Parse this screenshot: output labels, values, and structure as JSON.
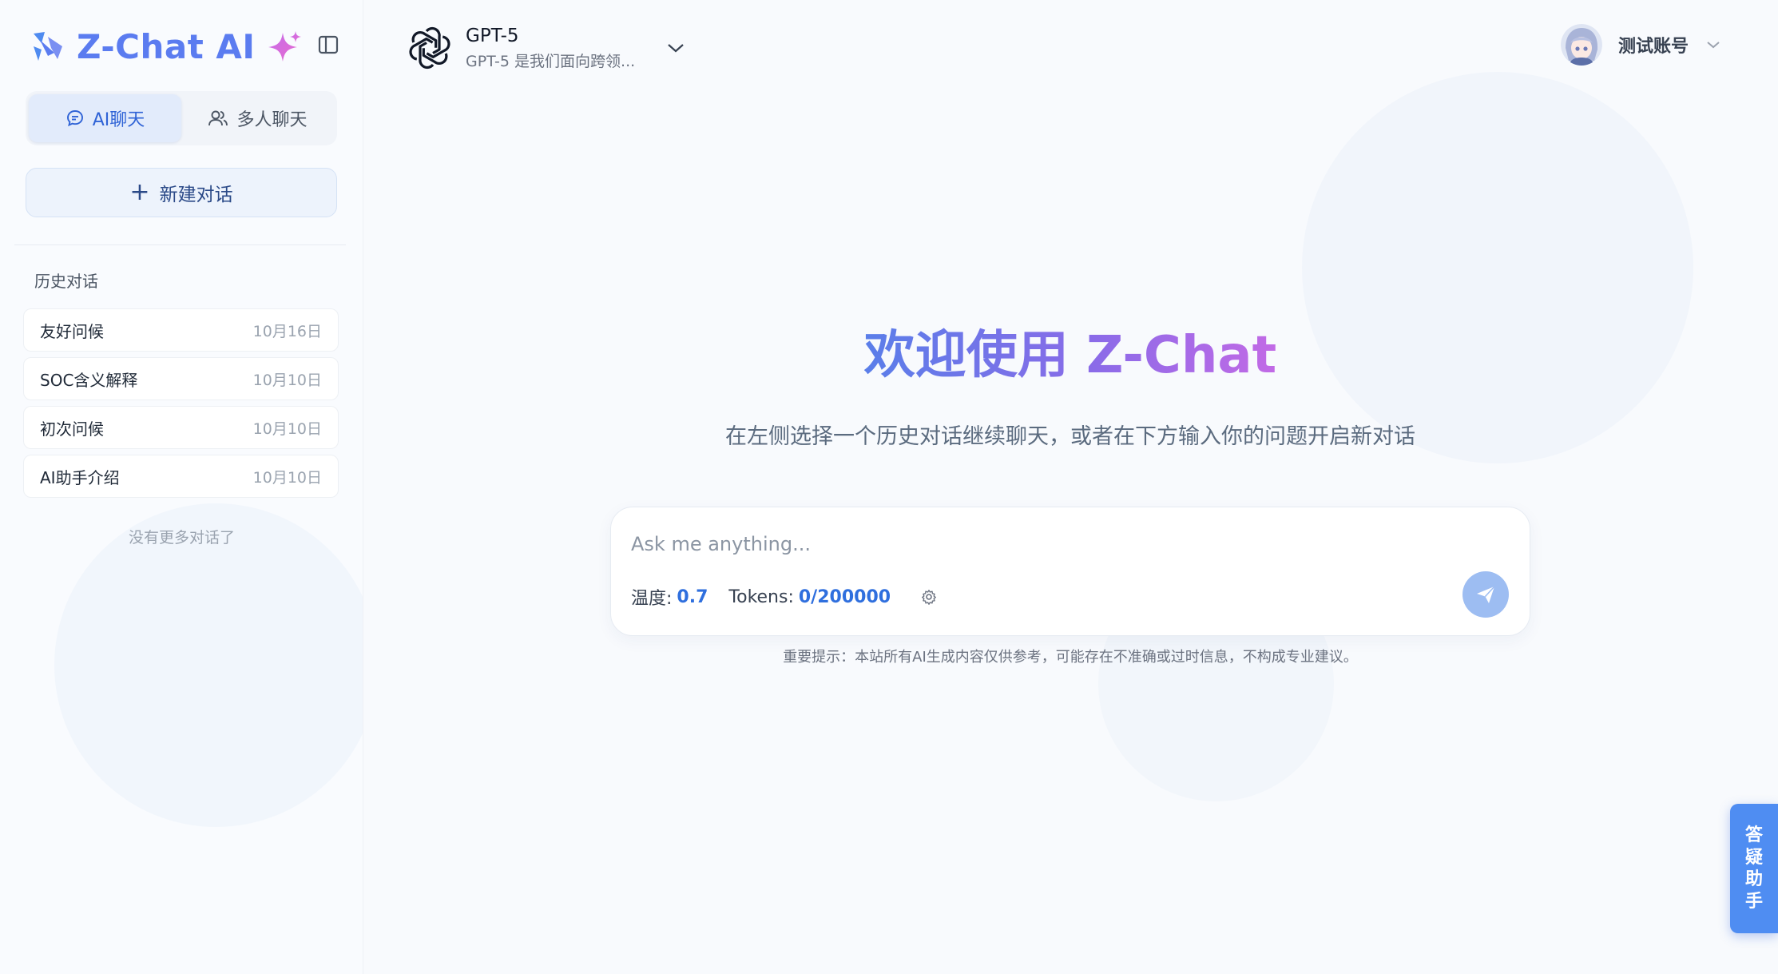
{
  "brand": {
    "name": "Z-Chat AI"
  },
  "sidebar": {
    "tabs": [
      {
        "label": "AI聊天",
        "active": true,
        "icon": "chat-bubble-icon"
      },
      {
        "label": "多人聊天",
        "active": false,
        "icon": "users-icon"
      }
    ],
    "new_chat_label": "新建对话",
    "history_title": "历史对话",
    "history": [
      {
        "title": "友好问候",
        "date": "10月16日"
      },
      {
        "title": "SOC含义解释",
        "date": "10月10日"
      },
      {
        "title": "初次问候",
        "date": "10月10日"
      },
      {
        "title": "AI助手介绍",
        "date": "10月10日"
      }
    ],
    "no_more": "没有更多对话了"
  },
  "header": {
    "model_name": "GPT-5",
    "model_desc": "GPT-5 是我们面向跨领...",
    "user_name": "测试账号"
  },
  "main": {
    "welcome": "欢迎使用 Z-Chat",
    "subtitle": "在左侧选择一个历史对话继续聊天，或者在下方输入你的问题开启新对话",
    "input_placeholder": "Ask me anything...",
    "temperature_label": "温度:",
    "temperature_value": "0.7",
    "tokens_label": "Tokens:",
    "tokens_value": "0/200000",
    "notice": "重要提示：本站所有AI生成内容仅供参考，可能存在不准确或过时信息，不构成专业建议。"
  },
  "helper_label": "答\n疑\n助\n手",
  "colors": {
    "accent": "#2f6fde",
    "brand": "#5b7cf0",
    "send": "#9dbdf2",
    "helper": "#4f8df2"
  }
}
